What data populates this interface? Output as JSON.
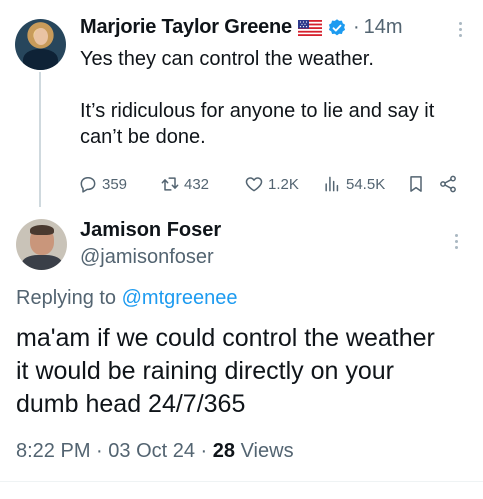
{
  "parent_tweet": {
    "author_name": "Marjorie Taylor Greene",
    "flag_icon": "us-flag-icon",
    "verified_color": "#1d9bf0",
    "separator": "·",
    "time": "14m",
    "text": "Yes they can control the weather.\n\nIt’s ridiculous for anyone to lie and say it can’t be done.",
    "actions": {
      "replies": "359",
      "reposts": "432",
      "likes": "1.2K",
      "views": "54.5K"
    }
  },
  "reply_tweet": {
    "author_name": "Jamison Foser",
    "handle": "@jamisonfoser",
    "replying_prefix": "Replying to",
    "replying_to": "@mtgreenee",
    "text": "ma'am if we could control the weather\nit would be raining directly on your\ndumb head 24/7/365",
    "time": "8:22 PM",
    "date": "03 Oct 24",
    "views_count": "28",
    "views_label": "Views"
  },
  "colors": {
    "text_primary": "#0f1419",
    "text_secondary": "#536471",
    "link": "#1d9bf0"
  }
}
